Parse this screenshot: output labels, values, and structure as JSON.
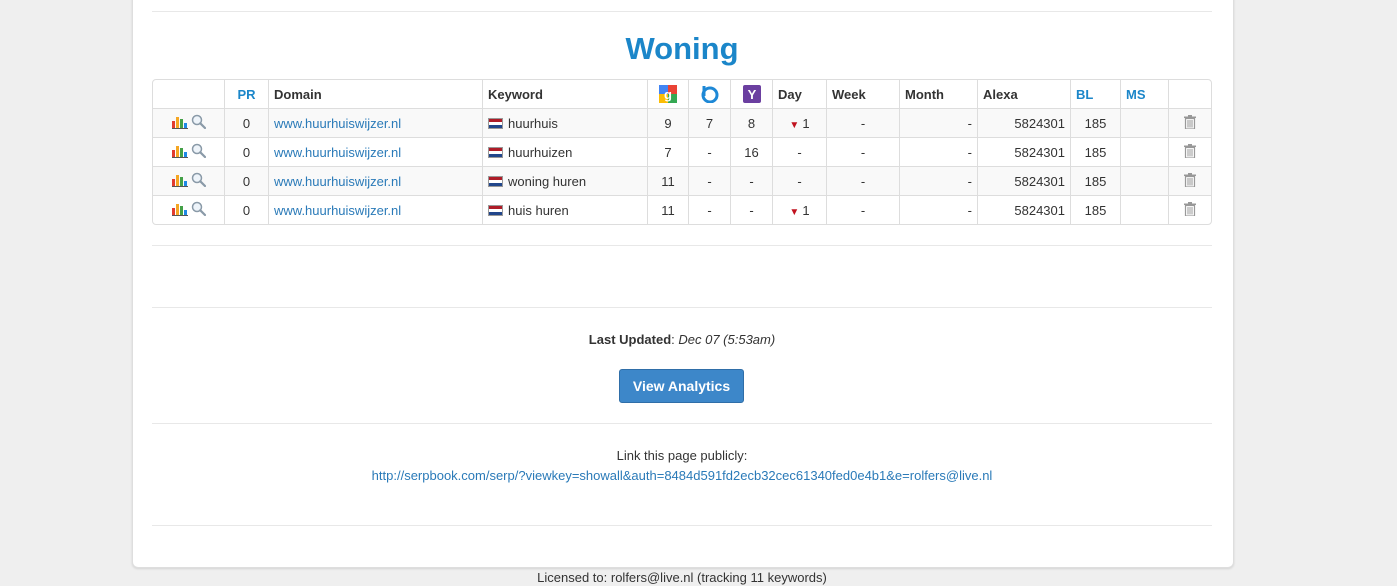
{
  "section_title": "Woning",
  "table": {
    "headers": {
      "pr": "PR",
      "domain": "Domain",
      "keyword": "Keyword",
      "google": "google-icon",
      "bing": "bing-icon",
      "yahoo": "yahoo-icon",
      "day": "Day",
      "week": "Week",
      "month": "Month",
      "alexa": "Alexa",
      "bl": "BL",
      "ms": "MS"
    },
    "rows": [
      {
        "pr": "0",
        "domain": "www.huurhuiswijzer.nl",
        "keyword": "huurhuis",
        "google": "9",
        "bing": "7",
        "yahoo": "8",
        "day": "1",
        "day_trend": "down",
        "week": "-",
        "month": "-",
        "alexa": "5824301",
        "bl": "185",
        "ms": ""
      },
      {
        "pr": "0",
        "domain": "www.huurhuiswijzer.nl",
        "keyword": "huurhuizen",
        "google": "7",
        "bing": "-",
        "yahoo": "16",
        "day": "-",
        "day_trend": "",
        "week": "-",
        "month": "-",
        "alexa": "5824301",
        "bl": "185",
        "ms": ""
      },
      {
        "pr": "0",
        "domain": "www.huurhuiswijzer.nl",
        "keyword": "woning huren",
        "google": "11",
        "bing": "-",
        "yahoo": "-",
        "day": "-",
        "day_trend": "",
        "week": "-",
        "month": "-",
        "alexa": "5824301",
        "bl": "185",
        "ms": ""
      },
      {
        "pr": "0",
        "domain": "www.huurhuiswijzer.nl",
        "keyword": "huis huren",
        "google": "11",
        "bing": "-",
        "yahoo": "-",
        "day": "1",
        "day_trend": "down",
        "week": "-",
        "month": "-",
        "alexa": "5824301",
        "bl": "185",
        "ms": ""
      }
    ]
  },
  "last_updated": {
    "label": "Last Updated",
    "value": "Dec 07 (5:53am)"
  },
  "analytics_button": "View Analytics",
  "public_link": {
    "label": "Link this page publicly:",
    "url": "http://serpbook.com/serp/?viewkey=showall&auth=8484d591fd2ecb32cec61340fed0e4b1&e=rolfers@live.nl"
  },
  "footer": "Licensed to: rolfers@live.nl (tracking 11 keywords)",
  "colors": {
    "accent": "#1b86c9",
    "button": "#3d87c9",
    "trend_down": "#c1121f"
  }
}
